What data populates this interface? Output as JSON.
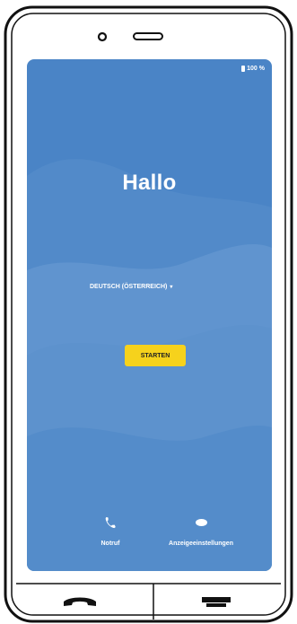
{
  "status_bar": {
    "battery": "100 %"
  },
  "greeting": "Hallo",
  "language": {
    "selected": "DEUTSCH (ÖSTERREICH)"
  },
  "start_button": "STARTEN",
  "actions": {
    "emergency": "Notruf",
    "display_settings": "Anzeigeeinstellungen"
  },
  "colors": {
    "screen_background": "#4a84c6",
    "start_button": "#f6d21c"
  },
  "icons": {
    "emergency": "phone-icon",
    "display_settings": "eye-icon",
    "left_hardware_key": "call-end-icon",
    "right_hardware_key": "menu-key-icon"
  }
}
